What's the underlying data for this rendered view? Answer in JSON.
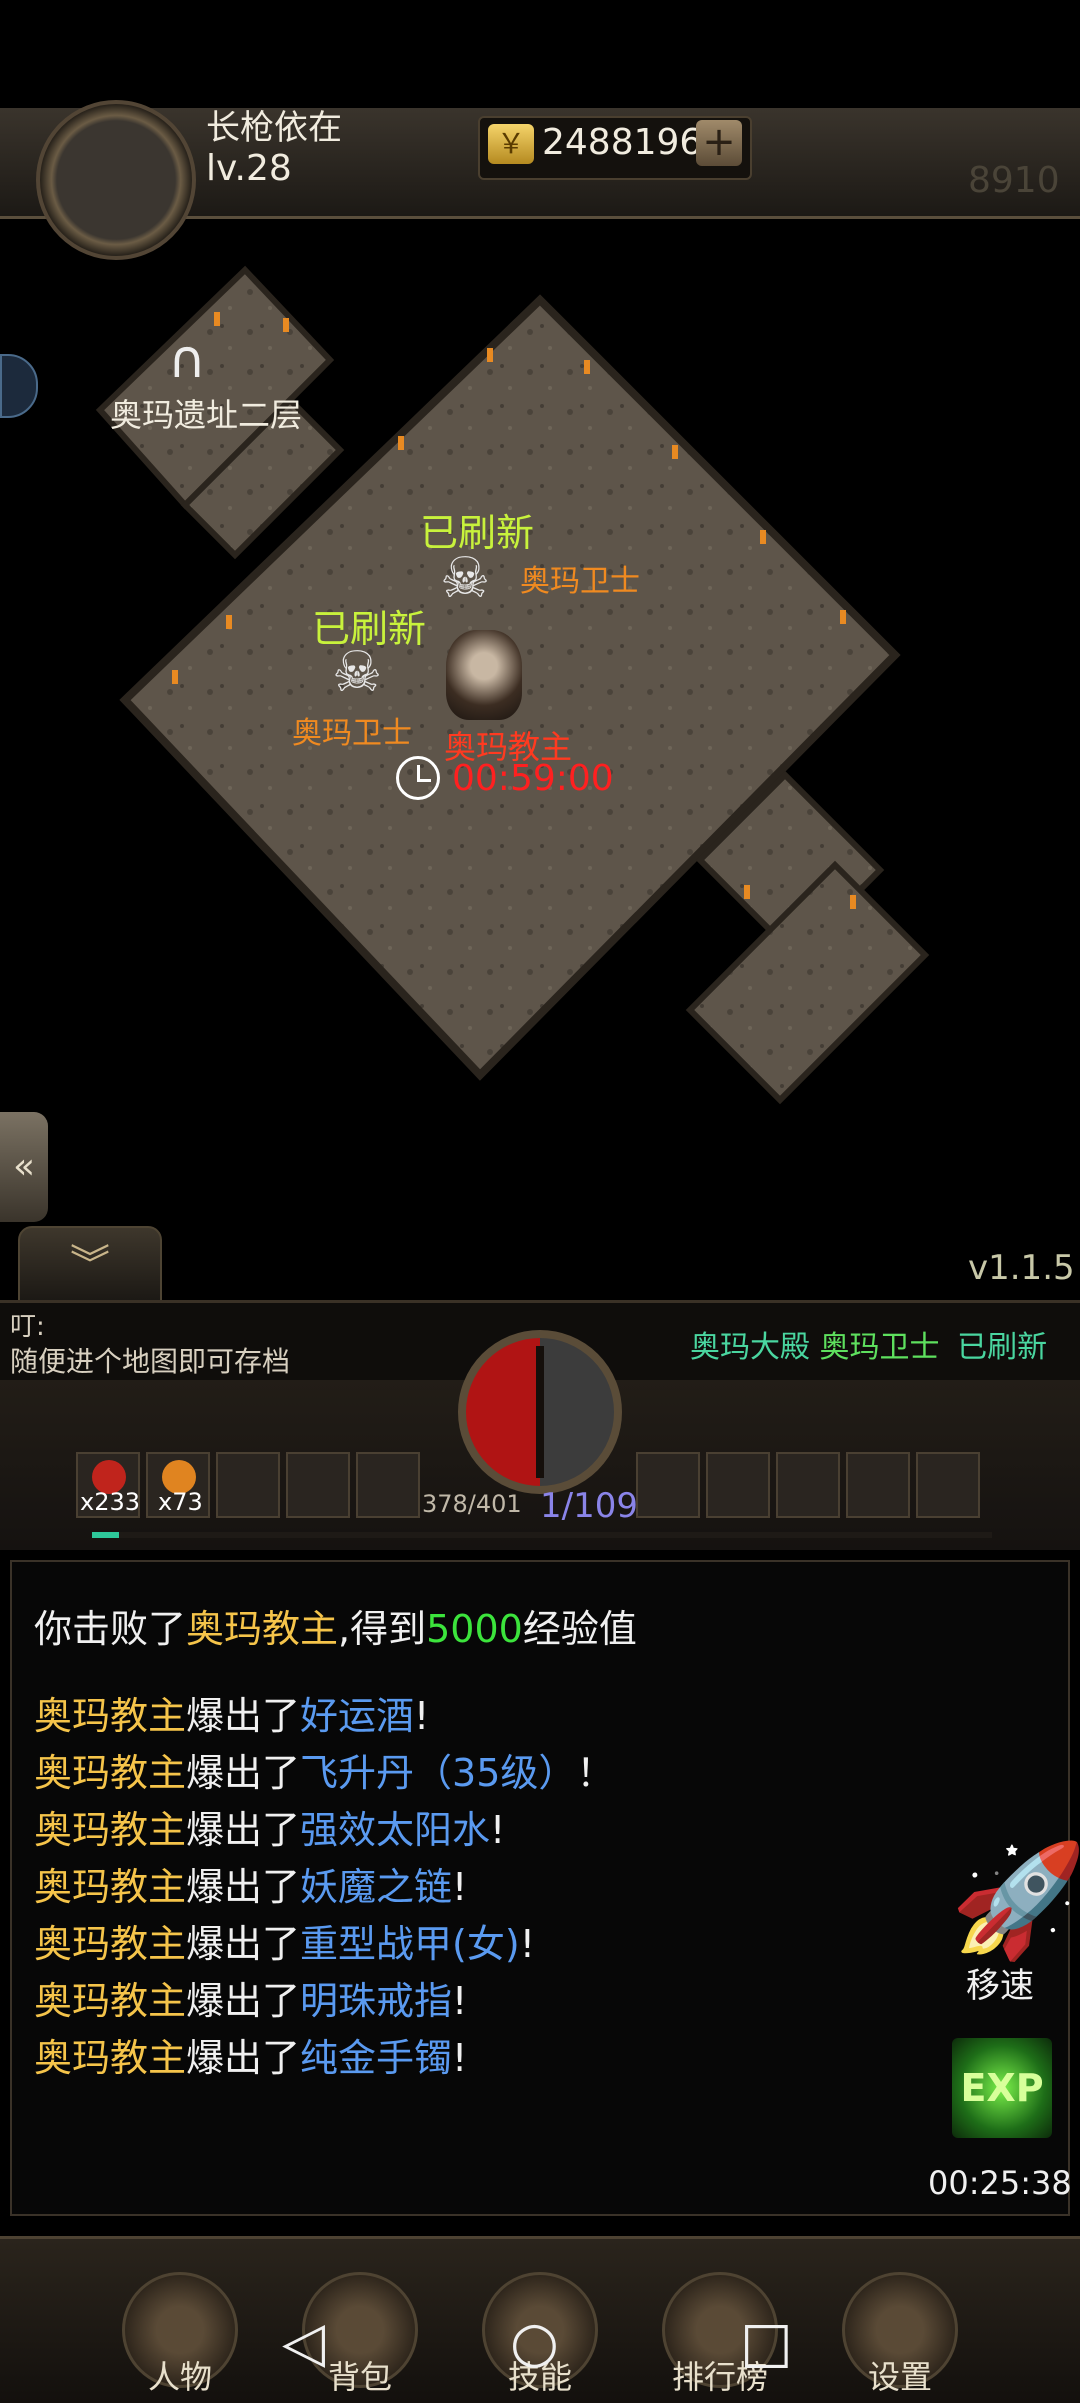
{
  "player": {
    "name": "长枪依在",
    "level": "lv.28",
    "gold": "2488196",
    "power": "8910"
  },
  "map": {
    "exit_name": "奥玛遗址二层",
    "version": "v1.1.5"
  },
  "spawns": {
    "refresh_label": "已刷新",
    "guard_name": "奥玛卫士",
    "boss_name": "奥玛教主",
    "boss_timer": "00:59:00"
  },
  "notice": {
    "title": "叮:",
    "message": "随便进个地图即可存档",
    "broadcast": {
      "map": "奥玛大殿",
      "monster": "奥玛卫士",
      "status": "已刷新"
    }
  },
  "skillbar": {
    "potion_red_count": "x233",
    "potion_orange_count": "x73",
    "hp": "378/401",
    "level_progress": "1/109",
    "exp_fraction": 0.01
  },
  "log": {
    "kill": {
      "prefix": "你击败了",
      "boss": "奥玛教主",
      "mid": ",得到",
      "exp": "5000",
      "suffix": "经验值"
    },
    "drop_source": "奥玛教主",
    "drop_verb": "爆出了",
    "drops": [
      {
        "item": "好运酒",
        "end": "!"
      },
      {
        "item": "飞升丹（35级）",
        "end": "！"
      },
      {
        "item": "强效太阳水",
        "end": "!"
      },
      {
        "item": "妖魔之链",
        "end": "!"
      },
      {
        "item": "重型战甲(女)",
        "end": "!"
      },
      {
        "item": "明珠戒指",
        "end": "!"
      },
      {
        "item": "纯金手镯",
        "end": "!"
      }
    ]
  },
  "side_actions": {
    "speed_label": "移速",
    "exp_label": "EXP",
    "exp_timer": "00:25:38"
  },
  "nav": {
    "character": "人物",
    "bag": "背包",
    "skills": "技能",
    "ranking": "排行榜",
    "settings": "设置"
  },
  "colors": {
    "yellow": "#f5c44a",
    "blue": "#5a9af0",
    "green": "#3ce43c",
    "timer_red": "#ff2020"
  }
}
